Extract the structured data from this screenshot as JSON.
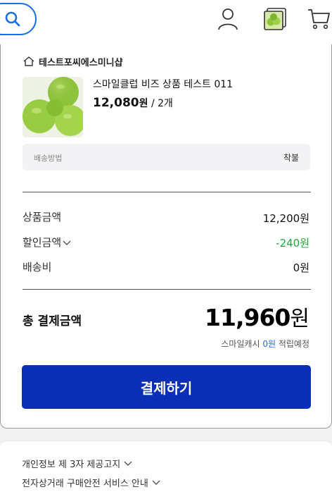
{
  "header": {
    "icons": [
      "search-icon",
      "user-icon",
      "recent-view-icon",
      "cart-icon"
    ],
    "accent_color": "#1a6fe6"
  },
  "order": {
    "seller_name": "테스트포씨에스미니샵",
    "product": {
      "name": "스마일클럽 비즈 상품 테스트 011",
      "price": "12,080",
      "currency": "원",
      "quantity": "/ 2개"
    },
    "shipping": {
      "label": "배송방법",
      "value": "착불"
    }
  },
  "summary": {
    "product_amount_label": "상품금액",
    "product_amount_value": "12,200원",
    "discount_label": "할인금액",
    "discount_value": "-240원",
    "shipping_fee_label": "배송비",
    "shipping_fee_value": "0원",
    "discount_color": "#21a53f"
  },
  "total": {
    "label": "총 결제금액",
    "amount": "11,960",
    "currency": "원",
    "cash_prefix": "스마일캐시",
    "cash_amount": "0원",
    "cash_suffix": "적립예정"
  },
  "pay_button": {
    "label": "결제하기",
    "color": "#0a2eb5"
  },
  "notices": [
    "개인정보 제 3자 제공고지",
    "전자상거래 구매안전 서비스 안내"
  ]
}
